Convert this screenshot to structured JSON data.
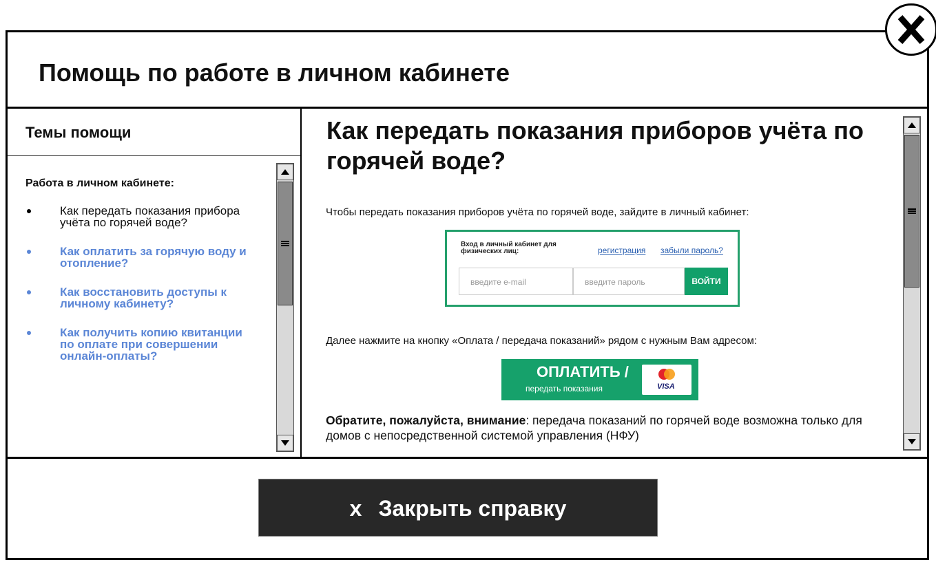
{
  "dialog": {
    "title": "Помощь по работе в личном кабинете",
    "close_icon": "close-x-icon"
  },
  "sidebar": {
    "heading": "Темы помощи",
    "category": "Работа в личном кабинете:",
    "items": [
      {
        "label": "Как передать показания прибора учёта по горячей воде?",
        "active": true
      },
      {
        "label": "Как оплатить за горячую воду и отопление?",
        "active": false
      },
      {
        "label": "Как восстановить доступы к личному кабинету?",
        "active": false
      },
      {
        "label": "Как получить копию квитанции по оплате при совершении онлайн-оплаты?",
        "active": false
      }
    ]
  },
  "article": {
    "title": "Как передать показания приборов учёта по горячей воде?",
    "intro": "Чтобы передать показания приборов учёта по горячей воде, зайдите в личный кабинет:",
    "login_form": {
      "title": "Вход в личный кабинет для физических лиц:",
      "register_link": "регистрация",
      "forgot_link": "забыли пароль?",
      "email_placeholder": "введите e-mail",
      "password_placeholder": "введите пароль",
      "submit_label": "ВОЙТИ"
    },
    "step2": "Далее нажмите на кнопку «Оплата / передача показаний» рядом с нужным Вам адресом:",
    "pay_button": {
      "main": "ОПЛАТИТЬ /",
      "sub": "передать показания",
      "card_brand": "VISA"
    },
    "note_bold": "Обратите, пожалуйста, внимание",
    "note_text": ": передача показаний по горячей воде возможна только для домов с непосредственной системой управления (НФУ)"
  },
  "footer": {
    "close_x": "x",
    "close_label": "Закрыть справку"
  },
  "colors": {
    "link": "#5b86d6",
    "brand_green": "#16a16b",
    "close_button_bg": "#282828"
  }
}
